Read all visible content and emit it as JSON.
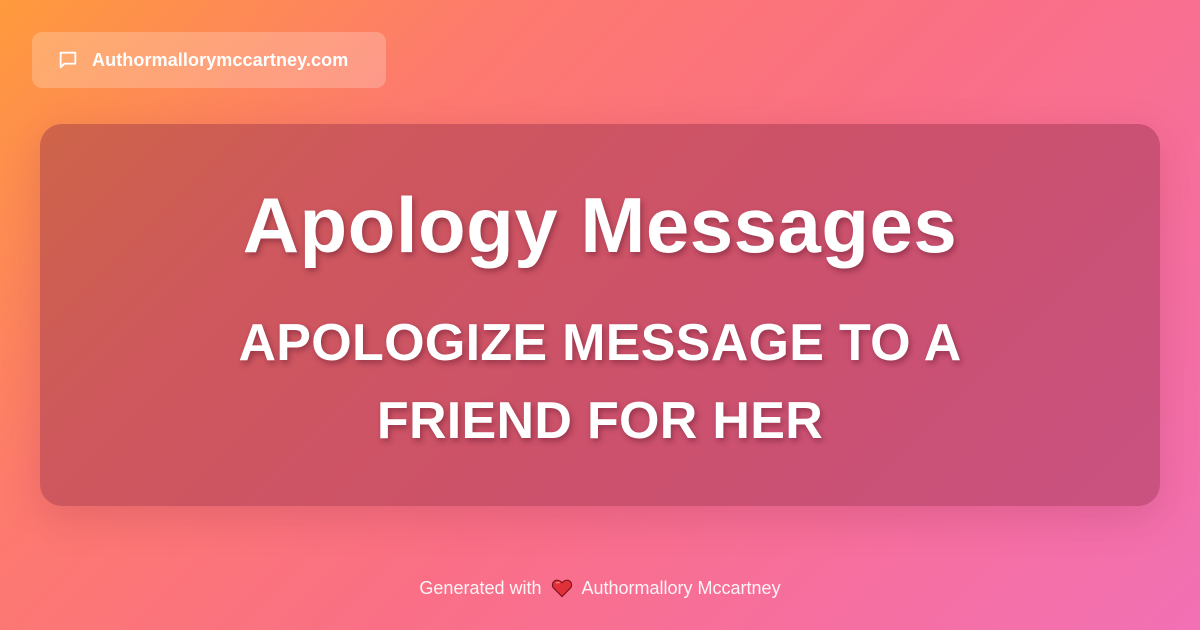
{
  "header": {
    "site_icon": "chat-bubble-icon",
    "domain": "Authormallorymccartney.com"
  },
  "card": {
    "title": "Apology Messages",
    "subtitle": "APOLOGIZE MESSAGE TO A FRIEND FOR HER"
  },
  "footer": {
    "prefix": "Generated with",
    "heart_icon": "heart-icon",
    "author": "Authormallory Mccartney"
  },
  "colors": {
    "gradient_start": "#ff9a3c",
    "gradient_end": "#f270b4",
    "heart": "#e0303a",
    "text": "#ffffff"
  }
}
